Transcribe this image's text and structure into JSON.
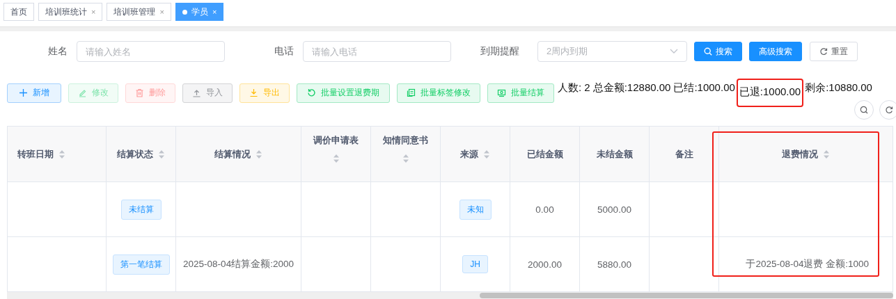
{
  "tabs": [
    {
      "label": "首页",
      "selected": false,
      "closable": false
    },
    {
      "label": "培训班统计",
      "selected": false,
      "closable": true
    },
    {
      "label": "培训班管理",
      "selected": false,
      "closable": true
    },
    {
      "label": "学员",
      "selected": true,
      "closable": true
    }
  ],
  "close_glyph": "×",
  "filters": [
    {
      "label": "姓名",
      "placeholder": "请输入姓名",
      "kind": "input"
    },
    {
      "label": "电话",
      "placeholder": "请输入电话",
      "kind": "input"
    },
    {
      "label": "到期提醒",
      "placeholder": "2周内到期",
      "kind": "select"
    }
  ],
  "search_buttons": [
    {
      "label": "搜索",
      "kind": "primary"
    },
    {
      "label": "高级搜索",
      "kind": "primary"
    },
    {
      "label": "重置",
      "kind": "default"
    }
  ],
  "toolbar": [
    {
      "label": "新增",
      "kind": "primary",
      "disabled": false
    },
    {
      "label": "修改",
      "kind": "success",
      "disabled": true
    },
    {
      "label": "删除",
      "kind": "danger",
      "disabled": true
    },
    {
      "label": "导入",
      "kind": "info",
      "disabled": false
    },
    {
      "label": "导出",
      "kind": "warning",
      "disabled": false
    },
    {
      "label": "批量设置退费期",
      "kind": "success",
      "disabled": false
    },
    {
      "label": "批量标签修改",
      "kind": "success",
      "disabled": false
    },
    {
      "label": "批量结算",
      "kind": "success",
      "disabled": false
    }
  ],
  "summary": [
    {
      "text": "人数: 2",
      "highlighted": false
    },
    {
      "text": "总金额:12880.00",
      "highlighted": false
    },
    {
      "text": "已结:1000.00",
      "highlighted": false
    },
    {
      "text": "已退:1000.00",
      "highlighted": true
    },
    {
      "text": "剩余:10880.00",
      "highlighted": false
    }
  ],
  "table": {
    "columns": [
      {
        "label": "转班日期",
        "sortable": true,
        "highlighted": false
      },
      {
        "label": "结算状态",
        "sortable": true,
        "highlighted": false
      },
      {
        "label": "结算情况",
        "sortable": true,
        "highlighted": false
      },
      {
        "label": "调价申请表",
        "sortable": true,
        "highlighted": false
      },
      {
        "label": "知情同意书",
        "sortable": true,
        "highlighted": false
      },
      {
        "label": "来源",
        "sortable": true,
        "highlighted": false
      },
      {
        "label": "已结金额",
        "sortable": false,
        "highlighted": false
      },
      {
        "label": "未结金额",
        "sortable": false,
        "highlighted": false
      },
      {
        "label": "备注",
        "sortable": false,
        "highlighted": false
      },
      {
        "label": "退费情况",
        "sortable": true,
        "highlighted": true
      }
    ],
    "rows": [
      {
        "cells": [
          {
            "kind": "text",
            "text": ""
          },
          {
            "kind": "tag",
            "text": "未结算"
          },
          {
            "kind": "text",
            "text": ""
          },
          {
            "kind": "text",
            "text": ""
          },
          {
            "kind": "text",
            "text": ""
          },
          {
            "kind": "tag",
            "text": "未知"
          },
          {
            "kind": "text",
            "text": "0.00"
          },
          {
            "kind": "text",
            "text": "5000.00"
          },
          {
            "kind": "text",
            "text": ""
          },
          {
            "kind": "text",
            "text": ""
          }
        ]
      },
      {
        "cells": [
          {
            "kind": "text",
            "text": ""
          },
          {
            "kind": "tag",
            "text": "第一笔结算"
          },
          {
            "kind": "text",
            "text": "2025-08-04结算金额:2000"
          },
          {
            "kind": "text",
            "text": ""
          },
          {
            "kind": "text",
            "text": ""
          },
          {
            "kind": "tag",
            "text": "JH"
          },
          {
            "kind": "text",
            "text": "2000.00"
          },
          {
            "kind": "text",
            "text": "5880.00"
          },
          {
            "kind": "text",
            "text": ""
          },
          {
            "kind": "text",
            "text": "于2025-08-04退费 金额:1000"
          }
        ]
      }
    ]
  }
}
